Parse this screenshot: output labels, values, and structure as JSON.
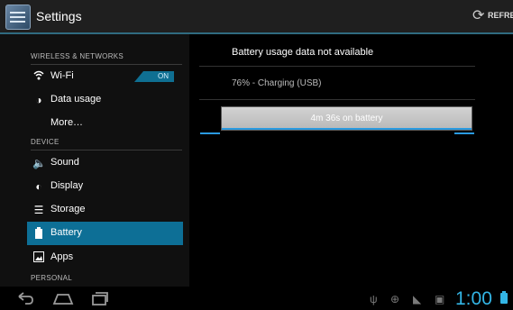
{
  "actionbar": {
    "title": "Settings",
    "refresh_label": "REFRESH"
  },
  "sidebar": {
    "sections": {
      "wireless": "WIRELESS & NETWORKS",
      "device": "DEVICE",
      "personal": "PERSONAL"
    },
    "items": [
      {
        "label": "Wi-Fi",
        "icon": "wifi-icon"
      },
      {
        "label": "Data usage",
        "icon": "data-usage-icon"
      },
      {
        "label": "More…",
        "icon": ""
      },
      {
        "label": "Sound",
        "icon": "sound-icon"
      },
      {
        "label": "Display",
        "icon": "display-icon"
      },
      {
        "label": "Storage",
        "icon": "storage-icon"
      },
      {
        "label": "Battery",
        "icon": "battery-icon"
      },
      {
        "label": "Apps",
        "icon": "apps-icon"
      }
    ],
    "wifi_toggle": "ON"
  },
  "main": {
    "title": "Battery usage data not available",
    "status": "76% - Charging (USB)",
    "bar_label": "4m 36s on battery"
  },
  "navbar": {
    "clock": "1:00"
  },
  "colors": {
    "accent": "#33b5e5",
    "active_item": "#0d6f96"
  }
}
